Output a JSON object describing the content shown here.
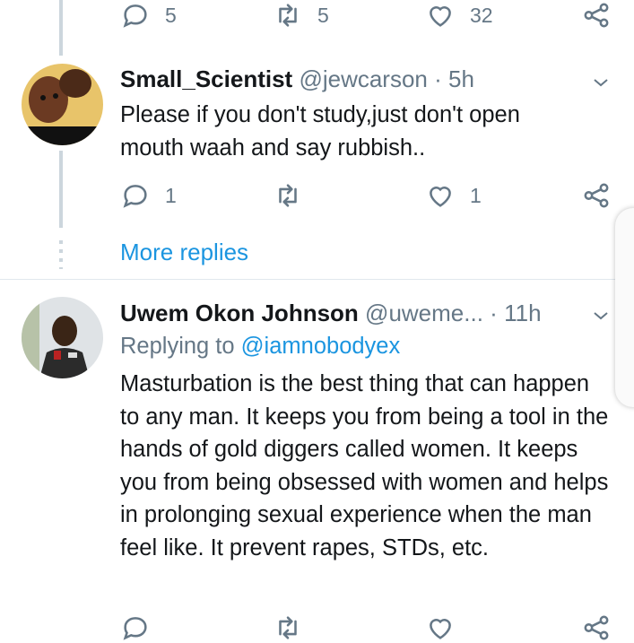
{
  "top_actions": {
    "reply_count": "5",
    "retweet_count": "5",
    "like_count": "32"
  },
  "reply1": {
    "name": "Small_Scientist",
    "handle": "@jewcarson",
    "separator": "·",
    "time": "5h",
    "text": "Please if you don't study,just don't open mouth waah and say rubbish..",
    "actions": {
      "reply_count": "1",
      "retweet_count": "",
      "like_count": "1"
    }
  },
  "more_replies": "More replies",
  "reply2": {
    "name": "Uwem Okon Johnson",
    "handle": "@uweme...",
    "separator": "·",
    "time": "11h",
    "replying_prefix": "Replying to",
    "replying_handle": "@iamnobodyex",
    "text": "Masturbation is the best thing that can happen to any man. It keeps you from being a tool in the hands of gold diggers called women. It keeps you from being obsessed with women and helps in prolonging sexual experience when the man feel like. It prevent rapes, STDs, etc."
  },
  "colors": {
    "accent": "#1b95e0",
    "secondary_text": "#657786",
    "thread_line": "#ccd6dd"
  }
}
